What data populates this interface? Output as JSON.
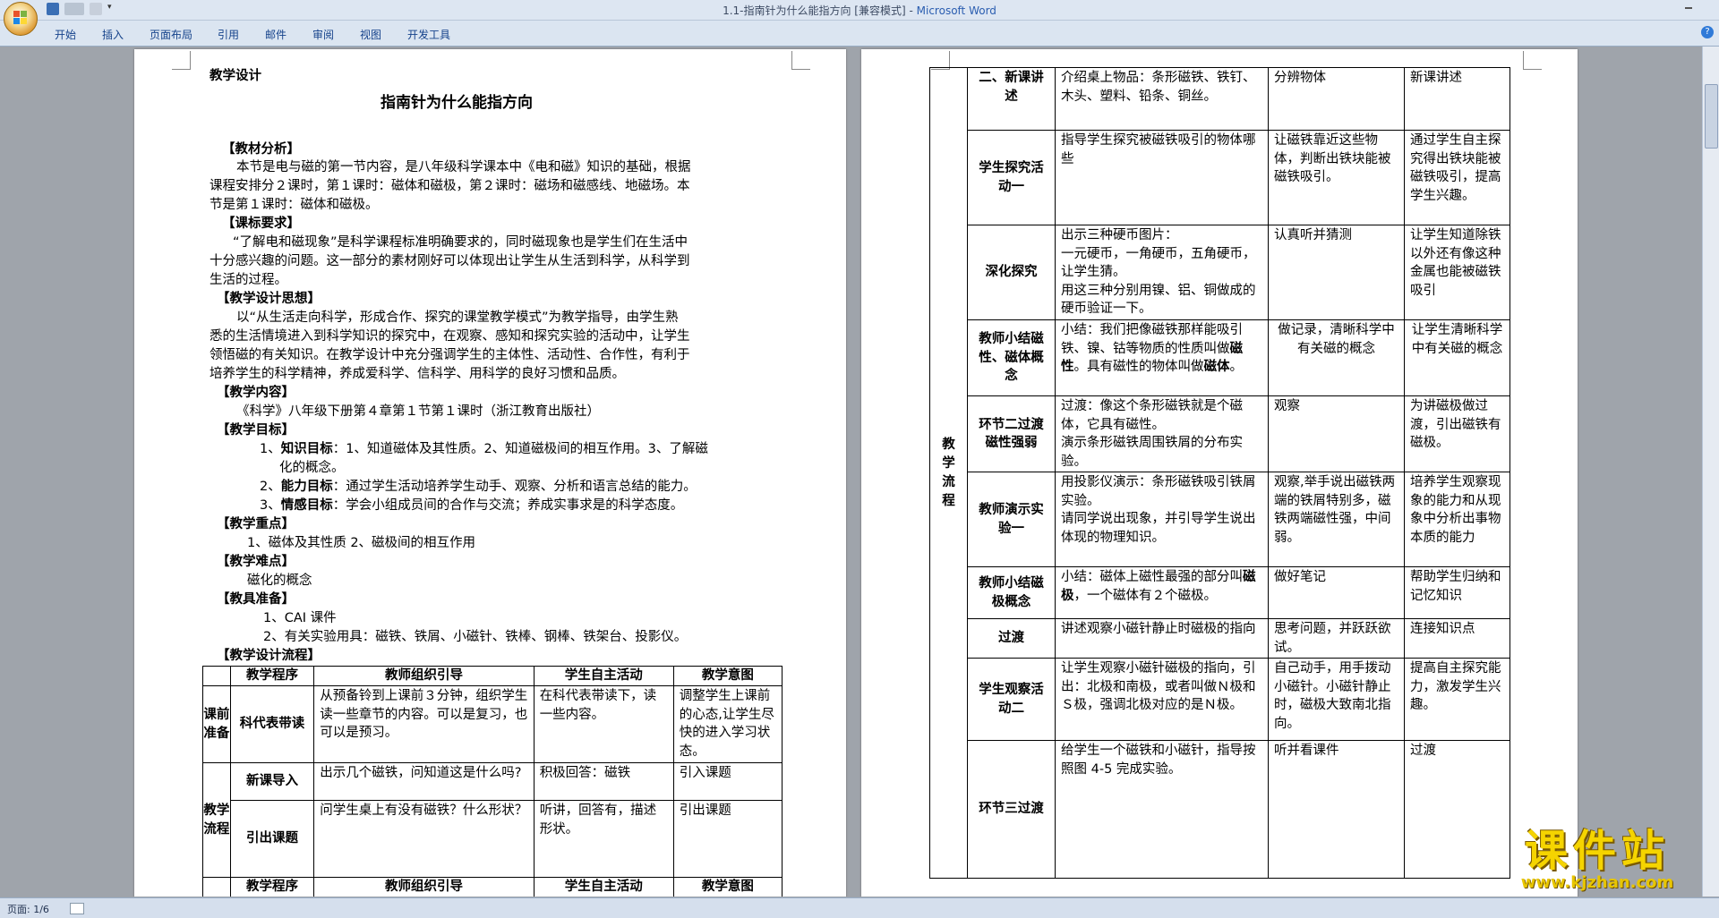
{
  "window": {
    "title": "1.1-指南针为什么能指方向 [兼容模式]",
    "separator": " - ",
    "app_name": "Microsoft Word"
  },
  "ribbon_tabs": [
    "开始",
    "插入",
    "页面布局",
    "引用",
    "邮件",
    "审阅",
    "视图",
    "开发工具"
  ],
  "status": {
    "page": "页面: 1/6"
  },
  "watermark": {
    "main": "课件站",
    "url": "www.kjzhan.com"
  },
  "doc": {
    "label": "教学设计",
    "title": "指南针为什么能指方向",
    "s1_head": "【教材分析】",
    "s1_lines": [
      "本节是电与磁的第一节内容，是八年级科学课本中《电和磁》知识的基础，根据",
      "课程安排分２课时，第１课时：磁体和磁极，第２课时：磁场和磁感线、地磁场。本",
      "节是第１课时：磁体和磁极。"
    ],
    "s2_head": "【课标要求】",
    "s2_lines": [
      "“了解电和磁现象”是科学课程标准明确要求的，同时磁现象也是学生们在生活中",
      "十分感兴趣的问题。这一部分的素材刚好可以体现出让学生从生活到科学，从科学到",
      "生活的过程。"
    ],
    "s3_head": "【教学设计思想】",
    "s3_lines": [
      "以“从生活走向科学，形成合作、探究的课堂教学模式”为教学指导，由学生熟",
      "悉的生活情境进入到科学知识的探究中，在观察、感知和探究实验的活动中，让学生",
      "领悟磁的有关知识。在教学设计中充分强调学生的主体性、活动性、合作性，有利于",
      "培养学生的科学精神，养成爱科学、信科学、用科学的良好习惯和品质。"
    ],
    "s4_head": "【教学内容】",
    "s4_line": "《科学》八年级下册第４章第１节第１课时（浙江教育出版社）",
    "s5_head": "【教学目标】",
    "goals": [
      {
        "num": "1、",
        "label": "知识目标",
        "text": "：1、知道磁体及其性质。2、知道磁极间的相互作用。3、了解磁",
        "cont": "化的概念。"
      },
      {
        "num": "2、",
        "label": "能力目标",
        "text": "：通过学生活动培养学生动手、观察、分析和语言总结的能力。"
      },
      {
        "num": "3、",
        "label": "情感目标",
        "text": "：学会小组成员间的合作与交流；养成实事求是的科学态度。"
      }
    ],
    "s6_head": "【教学重点】",
    "s6_line": "1、磁体及其性质  2、磁极间的相互作用",
    "s7_head": "【教学难点】",
    "s7_line": "磁化的概念",
    "s8_head": "【教具准备】",
    "s8_lines": [
      "1、CAI 课件",
      "2、有关实验用具：磁铁、铁屑、小磁针、铁棒、钢棒、铁架台、投影仪。"
    ],
    "s9_head": "【教学设计流程】"
  },
  "table_left": {
    "headers": [
      "教学程序",
      "教师组织引导",
      "学生自主活动",
      "教学意图"
    ],
    "group1": "课前准备",
    "group2": "教学流程",
    "rows": [
      {
        "step": "科代表带读",
        "teacher": "从预备铃到上课前３分钟，组织学生读一些章节的内容。可以是复习，也可以是预习。",
        "student": "在科代表带读下，读一些内容。",
        "intent": "调整学生上课前的心态,让学生尽快的进入学习状态。"
      },
      {
        "step": "新课导入",
        "teacher": "出示几个磁铁，问知道这是什么吗?",
        "student": "积极回答：磁铁",
        "intent": "引入课题"
      },
      {
        "step": "引出课题",
        "teacher": "问学生桌上有没有磁铁？什么形状？",
        "student": "听讲，回答有，描述形状。",
        "intent": "引出课题"
      }
    ]
  },
  "table_right": {
    "group": "教学流程",
    "rows": [
      {
        "step": "二、新课讲述",
        "teacher": "介绍桌上物品：条形磁铁、铁钉、木头、塑料、铅条、铜丝。",
        "student": "分辨物体",
        "intent": "新课讲述"
      },
      {
        "step": "学生探究活动一",
        "teacher": "指导学生探究被磁铁吸引的物体哪些",
        "student": "让磁铁靠近这些物体，判断出铁块能被磁铁吸引。",
        "intent": "通过学生自主探究得出铁块能被磁铁吸引，提高学生兴趣。"
      },
      {
        "step": "深化探究",
        "teacher_lines": [
          "出示三种硬币图片：",
          "一元硬币，一角硬币，五角硬币，让学生猜。",
          "用这三种分别用镍、铝、铜做成的硬币验证一下。"
        ],
        "student": "认真听并猜测",
        "intent": "让学生知道除铁以外还有像这种金属也能被磁铁吸引"
      },
      {
        "step": "教师小结磁性、磁体概念",
        "teacher_a": "小结：我们把像磁铁那样能吸引铁、镍、钴等物质的性质叫做",
        "teacher_b1": "磁性",
        "teacher_c": "。具有磁性的物体叫做",
        "teacher_b2": "磁体",
        "teacher_d": "。",
        "student": "做记录，清晰科学中有关磁的概念",
        "intent": "让学生清晰科学中有关磁的概念"
      },
      {
        "step": "环节二过渡磁性强弱",
        "teacher_lines": [
          "过渡：像这个条形磁铁就是个磁体，它具有磁性。",
          "演示条形磁铁周围铁屑的分布实验。"
        ],
        "student": "观察",
        "intent": "为讲磁极做过渡，引出磁铁有磁极。"
      },
      {
        "step": "教师演示实验一",
        "teacher_lines": [
          "用投影仪演示：条形磁铁吸引铁屑实验。",
          "请同学说出现象，并引导学生说出体现的物理知识。"
        ],
        "student": "观察,举手说出磁铁两端的铁屑特别多，磁铁两端磁性强，中间弱。",
        "intent": "培养学生观察现象的能力和从现象中分析出事物本质的能力"
      },
      {
        "step": "教师小结磁极概念",
        "teacher_a": "小结：磁体上磁性最强的部分叫",
        "teacher_b1": "磁极",
        "teacher_c": "，一个磁体有２个磁极。",
        "student": "做好笔记",
        "intent": "帮助学生归纳和记忆知识"
      },
      {
        "step": "过渡",
        "teacher": "讲述观察小磁针静止时磁极的指向",
        "student": "思考问题，并跃跃欲试。",
        "intent": "连接知识点"
      },
      {
        "step": "学生观察活动二",
        "teacher": "让学生观察小磁针磁极的指向，引出：北极和南极，或者叫做Ｎ极和Ｓ极，强调北极对应的是Ｎ极。",
        "student": "自己动手，用手拨动小磁针。小磁针静止时，磁极大致南北指向。",
        "intent": "提高自主探究能力，激发学生兴趣。"
      },
      {
        "step": "环节三过渡",
        "teacher": "给学生一个磁铁和小磁针，指导按照图 4-5 完成实验。",
        "student": "听并看课件",
        "intent": "过渡"
      }
    ]
  }
}
